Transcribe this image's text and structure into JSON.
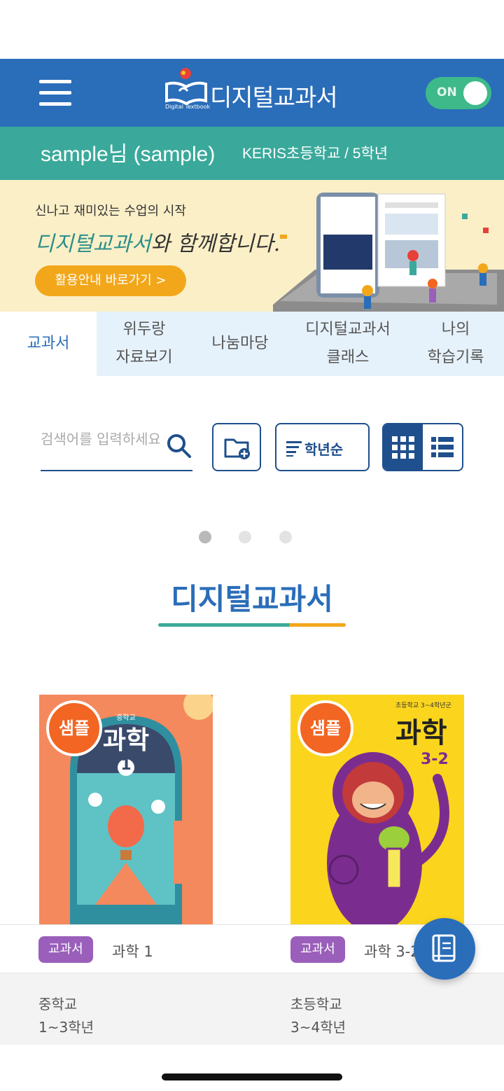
{
  "header": {
    "app_title": "디지털교과서",
    "logo_subtitle": "Digital Textbook",
    "toggle_label": "ON"
  },
  "user": {
    "name": "sample님 (sample)",
    "school": "KERIS초등학교 / 5학년"
  },
  "banner": {
    "line1": "신나고 재미있는 수업의 시작",
    "line2_highlight": "디지털교과서",
    "line2_rest": "와 함께합니다.",
    "button": "활용안내 바로가기 >"
  },
  "tabs": [
    {
      "line1": "교과서",
      "line2": ""
    },
    {
      "line1": "위두랑",
      "line2": "자료보기"
    },
    {
      "line1": "나눔마당",
      "line2": ""
    },
    {
      "line1": "디지털교과서",
      "line2": "클래스"
    },
    {
      "line1": "나의",
      "line2": "학습기록"
    }
  ],
  "toolbar": {
    "search_placeholder": "검색어를 입력하세요",
    "sort_label": "학년순"
  },
  "carousel": {
    "page_count": 3,
    "active_page": 1
  },
  "section_title": "디지털교과서",
  "books": [
    {
      "badge": "샘플",
      "type": "교과서",
      "title": "과학 1",
      "school_level": "중학교",
      "grade": "1~3학년",
      "cover_title": "과학",
      "cover_number": "1",
      "cover_small": "중학교"
    },
    {
      "badge": "샘플",
      "type": "교과서",
      "title": "과학 3-2",
      "school_level": "초등학교",
      "grade": "3~4학년",
      "cover_title": "과학",
      "cover_number": "3-2",
      "cover_small": "초등학교 3~4학년군"
    }
  ],
  "colors": {
    "primary": "#2a6db9",
    "teal": "#3aa99b",
    "accent": "#f2a71b",
    "chip": "#9a5fba",
    "badge": "#f26522"
  }
}
